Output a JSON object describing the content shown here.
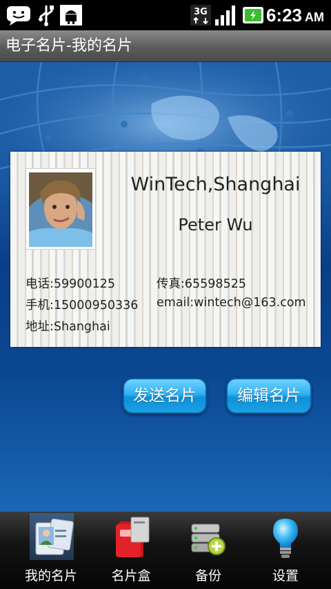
{
  "status_bar": {
    "time": "6:23",
    "ampm": "AM",
    "network": "3G",
    "icons": [
      "sms-icon",
      "usb-icon",
      "android-debug-icon",
      "3g-icon",
      "signal-icon",
      "battery-charging-icon"
    ]
  },
  "title_bar": {
    "title": "电子名片-我的名片"
  },
  "card": {
    "company": "WinTech,Shanghai",
    "name": "Peter Wu",
    "phone": "电话:59900125",
    "fax": "传真:65598525",
    "mobile": "手机:15000950336",
    "email": "email:wintech@163.com",
    "address": "地址:Shanghai"
  },
  "actions": {
    "send": "发送名片",
    "edit": "编辑名片"
  },
  "tabs": [
    {
      "label": "我的名片",
      "icon": "my-card-icon",
      "active": true
    },
    {
      "label": "名片盒",
      "icon": "card-box-icon",
      "active": false
    },
    {
      "label": "备份",
      "icon": "backup-icon",
      "active": false
    },
    {
      "label": "设置",
      "icon": "settings-bulb-icon",
      "active": false
    }
  ],
  "colors": {
    "accent_button": "#2fb0f2",
    "background_blue": "#0b4892",
    "title_bar": "#5c5c5c"
  }
}
